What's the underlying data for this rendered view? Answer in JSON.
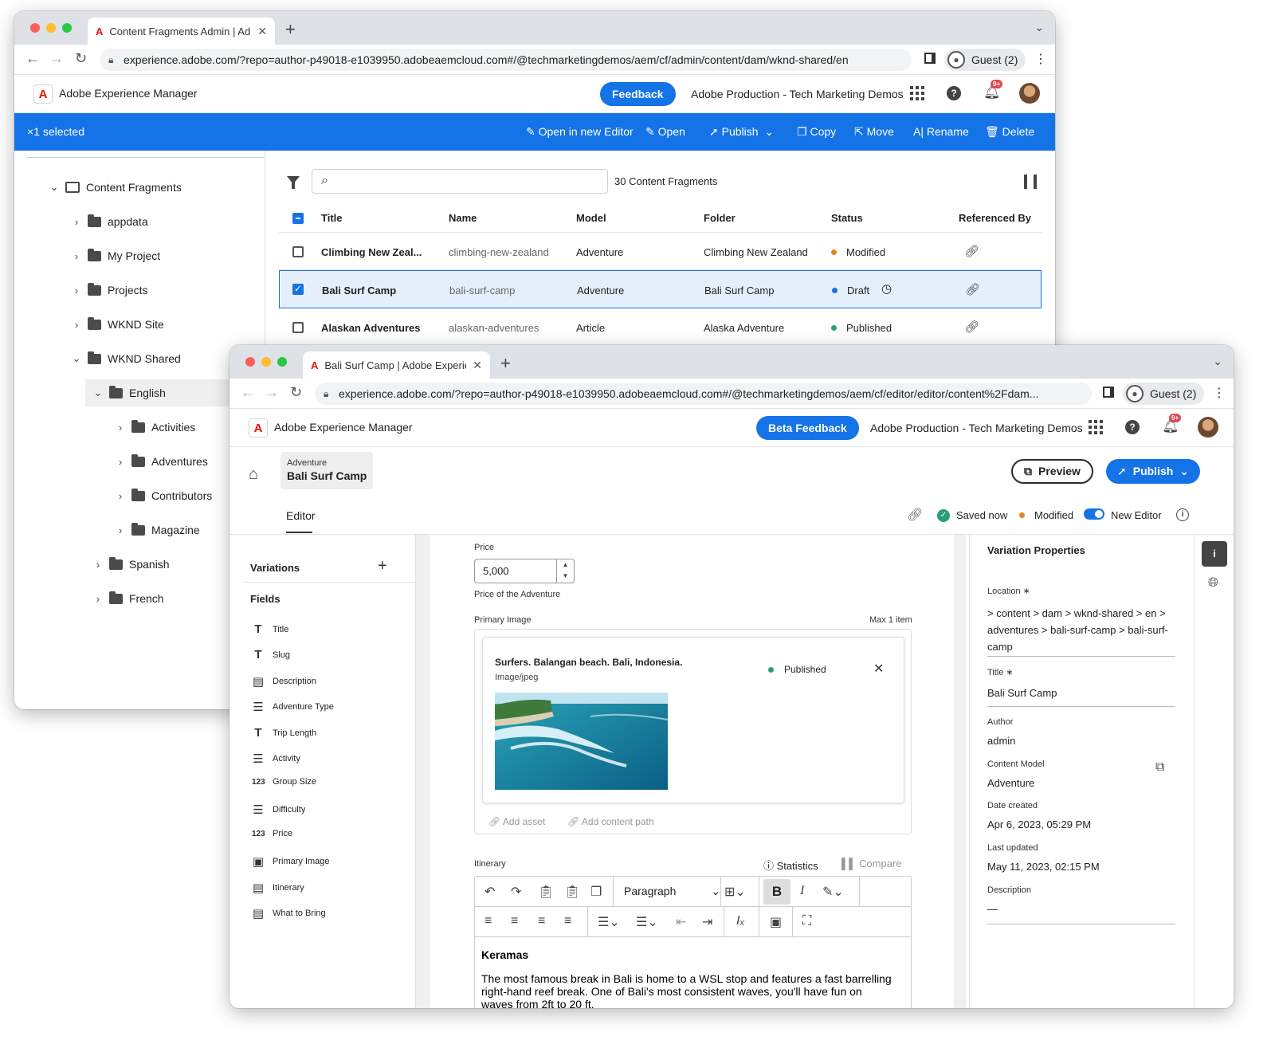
{
  "back_window": {
    "tab_title": "Content Fragments Admin | Ad",
    "url": "experience.adobe.com/?repo=author-p49018-e1039950.adobeaemcloud.com#/@techmarketingdemos/aem/cf/admin/content/dam/wknd-shared/en",
    "guest": "Guest (2)",
    "app_name": "Adobe Experience Manager",
    "feedback": "Feedback",
    "org": "Adobe Production - Tech Marketing Demos",
    "bell_badge": "9+",
    "actionbar": {
      "selected": "×1 selected",
      "open_new_editor": "Open in new Editor",
      "open": "Open",
      "publish": "Publish",
      "copy": "Copy",
      "move": "Move",
      "rename": "Rename",
      "delete": "Delete"
    },
    "tree": {
      "root": "Content Fragments",
      "items": [
        "appdata",
        "My Project",
        "Projects",
        "WKND Site",
        "WKND Shared"
      ],
      "english": "English",
      "english_children": [
        "Activities",
        "Adventures",
        "Contributors",
        "Magazine"
      ],
      "siblings": [
        "Spanish",
        "French"
      ]
    },
    "count": "30 Content Fragments",
    "columns": [
      "Title",
      "Name",
      "Model",
      "Folder",
      "Status",
      "Referenced By"
    ],
    "rows": [
      {
        "title": "Climbing New Zeal...",
        "name": "climbing-new-zealand",
        "model": "Adventure",
        "folder": "Climbing New Zealand",
        "status": "Modified",
        "color": "#e68619"
      },
      {
        "title": "Bali Surf Camp",
        "name": "bali-surf-camp",
        "model": "Adventure",
        "folder": "Bali Surf Camp",
        "status": "Draft",
        "color": "#1473e6"
      },
      {
        "title": "Alaskan Adventures",
        "name": "alaskan-adventures",
        "model": "Article",
        "folder": "Alaska Adventure",
        "status": "Published",
        "color": "#2d9d78"
      }
    ]
  },
  "front_window": {
    "tab_title": "Bali Surf Camp | Adobe Experie",
    "url": "experience.adobe.com/?repo=author-p49018-e1039950.adobeaemcloud.com#/@techmarketingdemos/aem/cf/editor/editor/content%2Fdam...",
    "guest": "Guest (2)",
    "app_name": "Adobe Experience Manager",
    "feedback": "Beta Feedback",
    "org": "Adobe Production - Tech Marketing Demos",
    "bell_badge": "9+",
    "breadcrumb": {
      "type": "Adventure",
      "name": "Bali Surf Camp"
    },
    "preview": "Preview",
    "publish": "Publish",
    "editor_tab": "Editor",
    "saved": "Saved now",
    "modified": "Modified",
    "new_editor": "New Editor",
    "variations": "Variations",
    "fields_heading": "Fields",
    "fields": [
      {
        "icon": "T",
        "label": "Title"
      },
      {
        "icon": "T",
        "label": "Slug"
      },
      {
        "icon": "▤",
        "label": "Description"
      },
      {
        "icon": "☰",
        "label": "Adventure Type"
      },
      {
        "icon": "T",
        "label": "Trip Length"
      },
      {
        "icon": "☰",
        "label": "Activity"
      },
      {
        "icon": "123",
        "label": "Group Size"
      },
      {
        "icon": "☰",
        "label": "Difficulty"
      },
      {
        "icon": "123",
        "label": "Price"
      },
      {
        "icon": "▣",
        "label": "Primary Image"
      },
      {
        "icon": "▤",
        "label": "Itinerary"
      },
      {
        "icon": "▤",
        "label": "What to Bring"
      }
    ],
    "price": {
      "label": "Price",
      "value": "5,000",
      "help": "Price of the Adventure"
    },
    "primary_image": {
      "label": "Primary Image",
      "max": "Max 1 item",
      "title": "Surfers. Balangan beach. Bali, Indonesia.",
      "type": "Image/jpeg",
      "status": "Published",
      "add_asset": "Add asset",
      "add_path": "Add content path"
    },
    "itinerary": {
      "label": "Itinerary",
      "statistics": "Statistics",
      "compare": "Compare",
      "paragraph": "Paragraph",
      "heading": "Keramas",
      "body": "The most famous break in Bali is home to a WSL stop and features a fast barrelling right-hand reef break. One of Bali's most consistent waves, you'll have fun on waves from 2ft to 20 ft."
    },
    "properties": {
      "title": "Variation Properties",
      "location_label": "Location ∗",
      "location": "> content > dam > wknd-shared > en > adventures > bali-surf-camp > bali-surf-camp",
      "title_label": "Title ∗",
      "title_value": "Bali Surf Camp",
      "author_label": "Author",
      "author": "admin",
      "model_label": "Content Model",
      "model": "Adventure",
      "created_label": "Date created",
      "created": "Apr 6, 2023, 05:29 PM",
      "updated_label": "Last updated",
      "updated": "May 11, 2023, 02:15 PM",
      "description_label": "Description",
      "description": "—"
    }
  }
}
